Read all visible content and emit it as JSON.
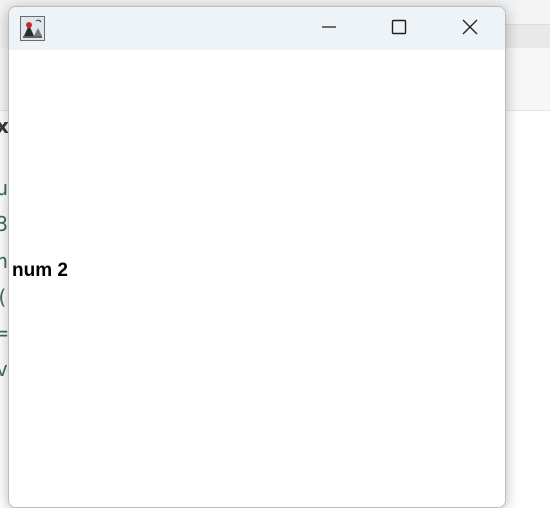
{
  "background": {
    "tab_fragment": "x",
    "code_fragments": [
      "u",
      "3",
      "n",
      "(",
      "=",
      "v"
    ]
  },
  "window": {
    "icon": "java-duke-icon",
    "controls": {
      "minimize": "minimize-icon",
      "maximize": "maximize-icon",
      "close": "close-icon"
    },
    "label": "num 2"
  }
}
